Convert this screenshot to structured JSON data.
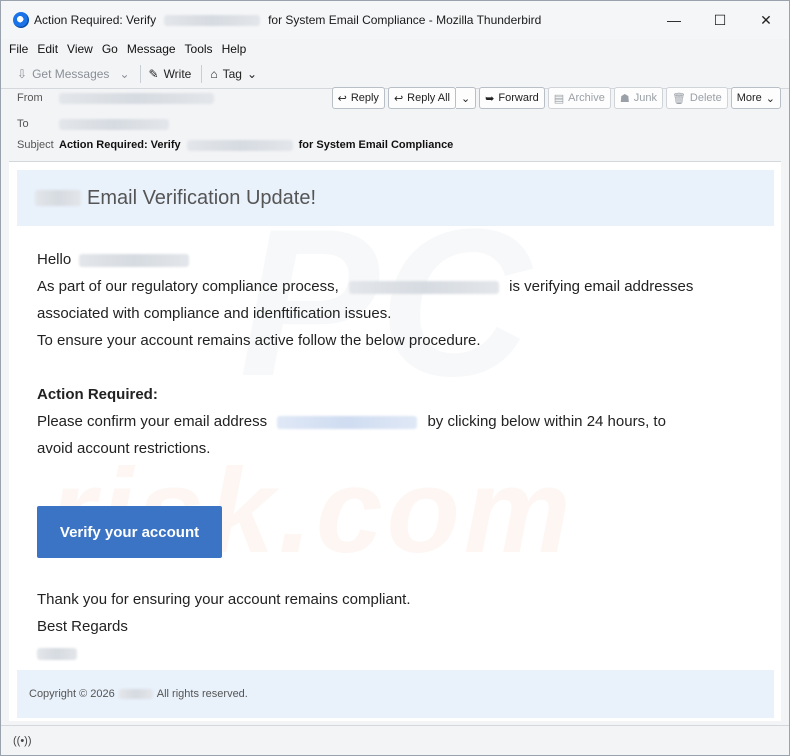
{
  "window": {
    "title_prefix": "Action Required: Verify",
    "title_suffix": "for System Email Compliance - Mozilla Thunderbird",
    "minimize_glyph": "—",
    "maximize_glyph": "☐",
    "close_glyph": "✕"
  },
  "menu": [
    "File",
    "Edit",
    "View",
    "Go",
    "Message",
    "Tools",
    "Help"
  ],
  "toolbar": {
    "get_messages": "Get Messages",
    "write": "Write",
    "tag": "Tag"
  },
  "header": {
    "from_label": "From",
    "to_label": "To",
    "subject_label": "Subject",
    "subject_prefix": "Action Required: Verify",
    "subject_suffix": "for System Email Compliance",
    "actions": {
      "reply": "Reply",
      "reply_all": "Reply All",
      "forward": "Forward",
      "archive": "Archive",
      "junk": "Junk",
      "delete": "Delete",
      "more": "More"
    }
  },
  "email": {
    "banner_title": "Email Verification Update!",
    "greeting": "Hello",
    "line1_a": "As part of our regulatory compliance process,",
    "line1_b": "is verifying email addresses",
    "line2": "associated with compliance and idenftification issues.",
    "line3": "To ensure your account remains active follow the below procedure.",
    "action_heading": "Action Required:",
    "confirm_a": "Please confirm your email address",
    "confirm_b": "by clicking below within 24 hours, to",
    "confirm_c": "avoid account restrictions.",
    "button_label": "Verify your account",
    "thanks": "Thank you for ensuring your account remains compliant.",
    "regards": "Best Regards",
    "footer_a": "Copyright © 2026",
    "footer_b": "All rights reserved."
  },
  "colors": {
    "button_bg": "#3b74c4",
    "banner_bg": "#e9f1fb"
  }
}
